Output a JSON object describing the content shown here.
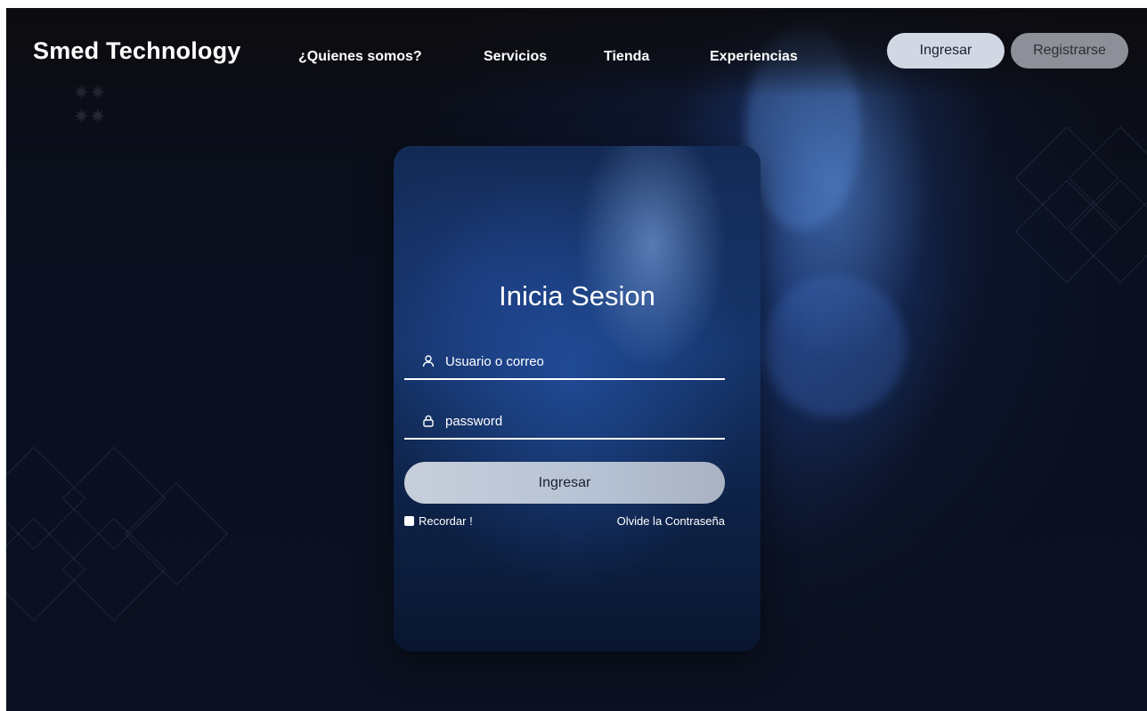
{
  "header": {
    "brand": "Smed Technology",
    "nav": [
      {
        "label": "¿Quienes somos?"
      },
      {
        "label": "Servicios"
      },
      {
        "label": "Tienda"
      },
      {
        "label": "Experiencias"
      }
    ],
    "login_button": "Ingresar",
    "register_button": "Registrarse"
  },
  "login": {
    "title": "Inicia Sesion",
    "username_placeholder": "Usuario o correo",
    "username_icon": "user-icon",
    "password_placeholder": "password",
    "password_icon": "lock-icon",
    "submit_label": "Ingresar",
    "remember_label": "Recordar !",
    "forgot_label": "Olvide la Contraseña"
  }
}
